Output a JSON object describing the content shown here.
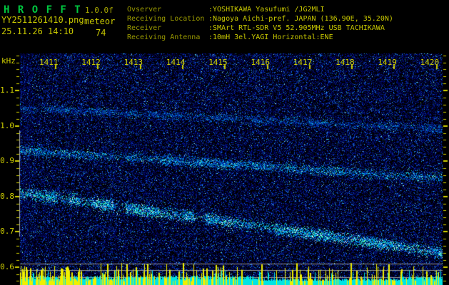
{
  "header": {
    "app_name": "H R O F F T",
    "version": "1.0.0f",
    "filename": "YY2511261410.png",
    "mode": "meteor",
    "datetime": "25.11.26 14:10",
    "count": "74",
    "info": [
      {
        "label": "Ovserver",
        "value": ":YOSHIKAWA Yasufumi /JG2MLI"
      },
      {
        "label": "Receiving Location",
        "value": ":Nagoya Aichi-pref. JAPAN (136.90E, 35.20N)"
      },
      {
        "label": "Receiver",
        "value": ":SMArt RTL-SDR V5 52.905MHz USB TACHIKAWA"
      },
      {
        "label": "Receiving Antenna",
        "value": ":10mH 3el.YAGI Horizontal:ENE"
      }
    ]
  },
  "chart_data": {
    "type": "heatmap",
    "description": "Radio meteor echo spectrogram: 10 minutes (1411-1420) vs audio frequency in kHz; blue noise field with slowly descending Doppler echo traces, gray reference lines near 0.6 kHz, solid cyan baseline band and yellow signal-level bars along the bottom",
    "x_axis": {
      "tick_labels": [
        "1411",
        "1412",
        "1413",
        "1414",
        "1415",
        "1416",
        "1417",
        "1418",
        "1419",
        "1420"
      ]
    },
    "y_axis": {
      "unit": "kHz",
      "tick_labels": [
        "1.1",
        "1.0",
        "0.9",
        "0.8",
        "0.7",
        "0.6"
      ],
      "range": [
        0.55,
        1.21
      ],
      "minor_tick_step_khz": 0.02
    },
    "bands": [
      {
        "name": "echo-trace-upper",
        "khz_start": 1.05,
        "khz_end": 0.99,
        "intensity": "faint"
      },
      {
        "name": "echo-trace-middle",
        "khz_start": 0.93,
        "khz_end": 0.85,
        "intensity": "medium"
      },
      {
        "name": "echo-trace-lower",
        "khz_start": 0.81,
        "khz_end": 0.64,
        "intensity": "strong"
      }
    ],
    "gray_guides_khz": [
      0.61,
      0.59,
      0.57
    ],
    "baseline_band_khz": [
      0.549,
      0.575
    ],
    "legend": "none",
    "grid": "off"
  },
  "colors": {
    "background": "#000000",
    "text_green": "#00c840",
    "text_yellow": "#c8c800",
    "text_olive": "#9a9a00",
    "axis_yellow": "#d2d200",
    "noise_blue": "#0000a0",
    "trace_cyan": "#00d0e0",
    "baseline_cyan": "#00e4e4",
    "bars_yellow": "#f0f000",
    "grid_gray": "#989898"
  }
}
